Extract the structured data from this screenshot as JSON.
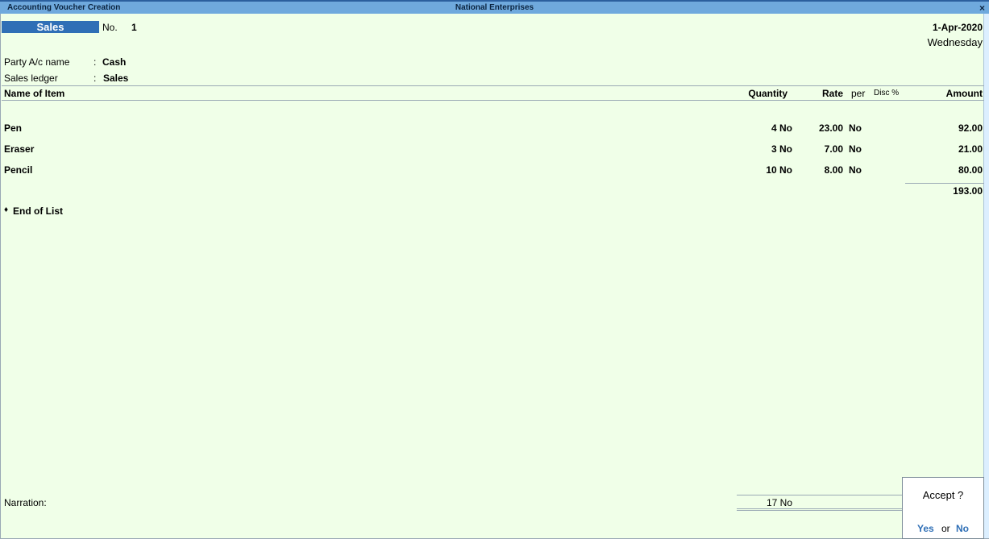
{
  "window": {
    "title_left": "Accounting Voucher Creation",
    "title_center": "National Enterprises",
    "close_glyph": "×"
  },
  "voucher": {
    "type": "Sales",
    "no_label": "No.",
    "no_value": "1",
    "date": "1-Apr-2020",
    "weekday": "Wednesday"
  },
  "party": {
    "label": "Party A/c name",
    "sep": ":",
    "value": "Cash"
  },
  "sales_ledger": {
    "label": "Sales ledger",
    "sep": ":",
    "value": "Sales"
  },
  "columns": {
    "item": "Name of Item",
    "quantity": "Quantity",
    "rate": "Rate",
    "per": "per",
    "disc": "Disc %",
    "amount": "Amount"
  },
  "items": [
    {
      "name": "Pen",
      "qty": "4 No",
      "rate": "23.00",
      "per": "No",
      "amount": "92.00"
    },
    {
      "name": "Eraser",
      "qty": "3 No",
      "rate": "7.00",
      "per": "No",
      "amount": "21.00"
    },
    {
      "name": "Pencil",
      "qty": "10 No",
      "rate": "8.00",
      "per": "No",
      "amount": "80.00"
    }
  ],
  "total_amount": "193.00",
  "end_of_list": {
    "bullet": "♦",
    "label": "End of List"
  },
  "narration": {
    "label": "Narration:",
    "total_qty": "17 No"
  },
  "accept_dialog": {
    "question": "Accept ?",
    "yes": "Yes",
    "or": "or",
    "no": "No"
  }
}
